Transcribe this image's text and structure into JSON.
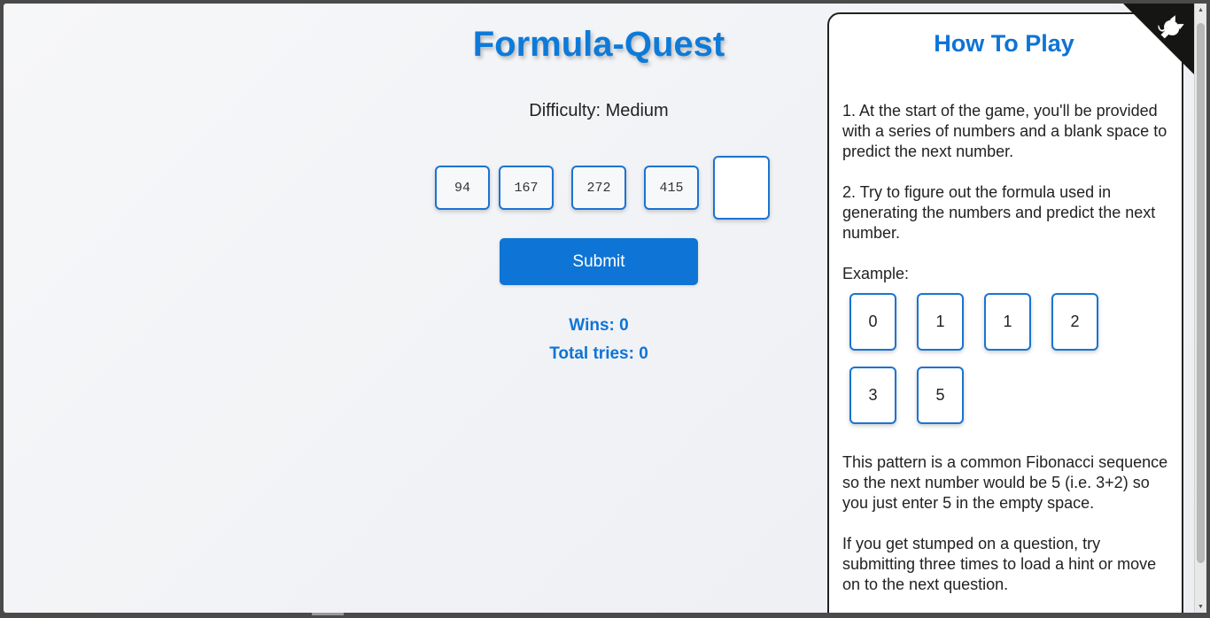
{
  "game": {
    "title": "Formula-Quest",
    "difficulty_label": "Difficulty: Medium",
    "sequence": [
      "94",
      "167",
      "272",
      "415"
    ],
    "answer_value": "",
    "submit_label": "Submit",
    "wins_label": "Wins: 0",
    "tries_label": "Total tries: 0"
  },
  "help": {
    "title": "How To Play",
    "step1": "1. At the start of the game, you'll be provided with a series of numbers and a blank space to predict the next number.",
    "step2": "2. Try to figure out the formula used in generating the numbers and predict the next number.",
    "example_label": "Example:",
    "example_sequence": [
      "0",
      "1",
      "1",
      "2",
      "3",
      "5"
    ],
    "explanation": "This pattern is a common Fibonacci sequence so the next number would be 5 (i.e. 3+2) so you just enter 5 in the empty space.",
    "hint_text": "If you get stumped on a question, try submitting three times to load a hint or move on to the next question."
  },
  "corner_icon": "github-octocat-icon",
  "colors": {
    "accent": "#0e74d6",
    "title": "#0e7ad8",
    "tile_border": "#1a74d2"
  }
}
